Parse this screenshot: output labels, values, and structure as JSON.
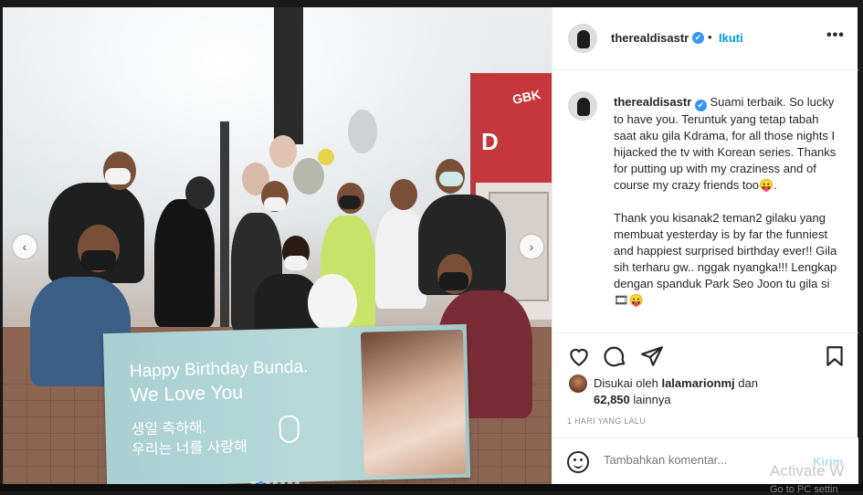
{
  "post": {
    "username": "therealdisastr",
    "verified": "✔",
    "follow_sep": "•",
    "follow_label": "Ikuti",
    "more_label": "•••",
    "caption_user": "therealdisastr",
    "caption_p1": "Suami terbaik. So lucky to have you. Teruntuk yang tetap tabah saat aku gila Kdrama, for all those nights I hijacked the tv with Korean series. Thanks for putting up with my craziness and of course my crazy friends too😛.",
    "caption_p2": "Thank you kisanak2 teman2 gilaku yang membuat yesterday is by far the funniest and happiest surprised birthday ever!! Gila sih terharu gw.. nggak nyangka!!! Lengkap dengan spanduk Park Seo Joon tu gila si🎞😛",
    "likes_prefix": "Disukai oleh",
    "likes_user": "lalamarionmj",
    "likes_mid": "dan",
    "likes_count": "62,850",
    "likes_suffix": "lainnya",
    "time_ago": "1 HARI YANG LALU"
  },
  "comment": {
    "placeholder": "Tambahkan komentar...",
    "post_label": "Kirim"
  },
  "photo": {
    "banner_line1": "Happy Birthday Bunda.",
    "banner_line2": "We Love You",
    "banner_kr1": "생일 축하해.",
    "banner_kr2": "우리는 너를 사랑해",
    "sign_brand": "GBK",
    "sign_letter": "D",
    "carousel_total": 7,
    "carousel_active": 1,
    "prev_arrow": "‹",
    "next_arrow": "›"
  },
  "icons": [
    "heart-icon",
    "comment-icon",
    "share-icon",
    "bookmark-icon",
    "emoji-icon",
    "more-icon"
  ],
  "overlay": {
    "watermark": "Activate W",
    "watermark_sub": "Go to PC settin"
  },
  "colors": {
    "accent": "#0095f6",
    "verified": "#3897f0",
    "post_disabled": "#b2dffc"
  }
}
